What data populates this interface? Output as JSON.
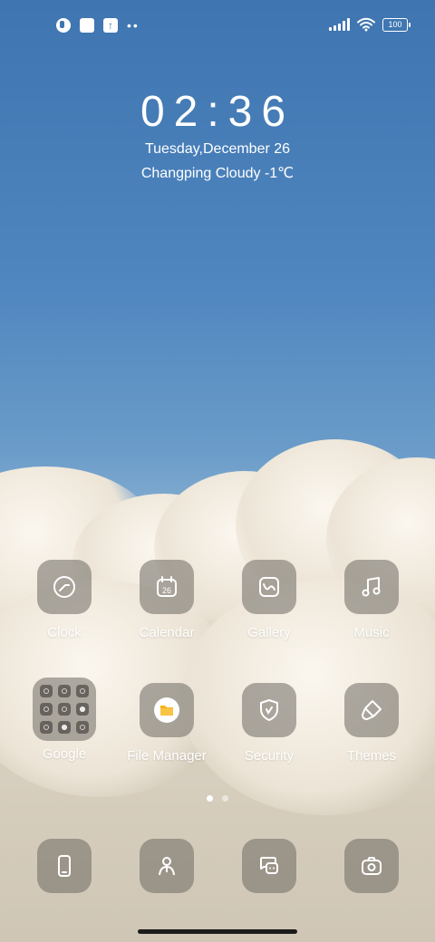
{
  "status_bar": {
    "battery": "100",
    "left_icons": [
      "notification-app-icon",
      "square-icon",
      "upload-icon",
      "more-dots-icon"
    ],
    "right_icons": [
      "signal-icon",
      "wifi-icon",
      "battery-icon"
    ]
  },
  "widget": {
    "time": "02:36",
    "date": "Tuesday,December 26",
    "weather": "Changping Cloudy -1℃"
  },
  "apps_row1": [
    {
      "label": "Clock",
      "icon": "clock-icon"
    },
    {
      "label": "Calendar",
      "icon": "calendar-icon",
      "badge": "26"
    },
    {
      "label": "Gallery",
      "icon": "gallery-icon"
    },
    {
      "label": "Music",
      "icon": "music-note-icon"
    }
  ],
  "apps_row2": [
    {
      "label": "Google",
      "icon": "folder-icon"
    },
    {
      "label": "File Manager",
      "icon": "file-manager-icon"
    },
    {
      "label": "Security",
      "icon": "shield-icon"
    },
    {
      "label": "Themes",
      "icon": "brush-icon"
    }
  ],
  "dock": [
    {
      "icon": "phone-icon"
    },
    {
      "icon": "contacts-icon"
    },
    {
      "icon": "messages-icon"
    },
    {
      "icon": "camera-icon"
    }
  ],
  "pages": {
    "total": 2,
    "current": 1
  },
  "colors": {
    "sky": "#4a7fb8",
    "icon_bg": "#6e6962",
    "folder_yellow": "#f5b21a"
  }
}
